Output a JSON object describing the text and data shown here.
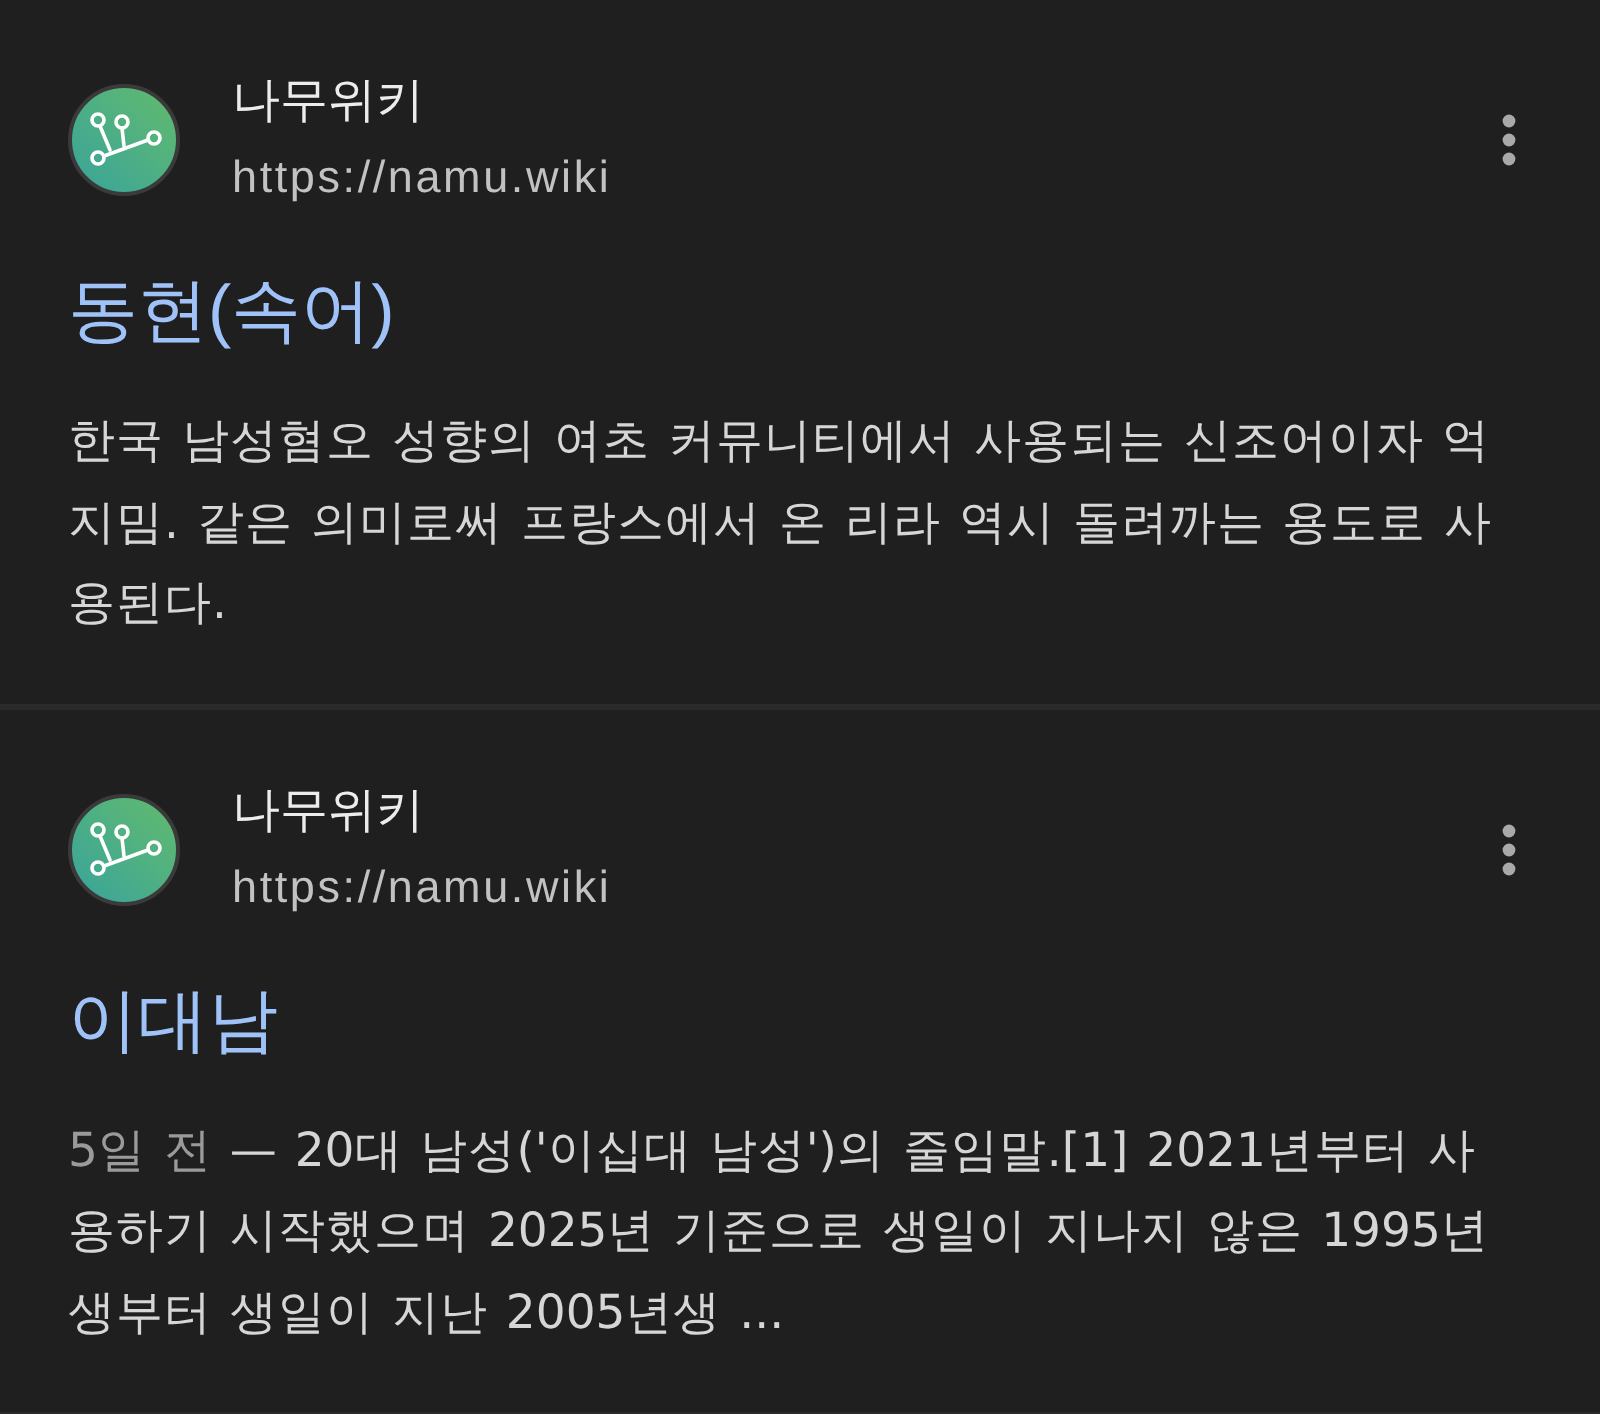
{
  "results": [
    {
      "site_name": "나무위키",
      "url": "https://namu.wiki",
      "title": "동현(속어)",
      "snippet": "한국 남성혐오 성향의 여초 커뮤니티에서 사용되는 신조어이자 억지밈. 같은 의미로써 프랑스에서 온 리라 역시 돌려까는 용도로 사용된다."
    },
    {
      "site_name": "나무위키",
      "url": "https://namu.wiki",
      "title": "이대남",
      "date": "5일 전",
      "snippet": "— 20대 남성('이십대 남성')의 줄임말.[1] 2021년부터 사용하기 시작했으며 2025년 기준으로 생일이 지나지 않은 1995년생부터 생일이 지난 2005년생 ..."
    }
  ]
}
